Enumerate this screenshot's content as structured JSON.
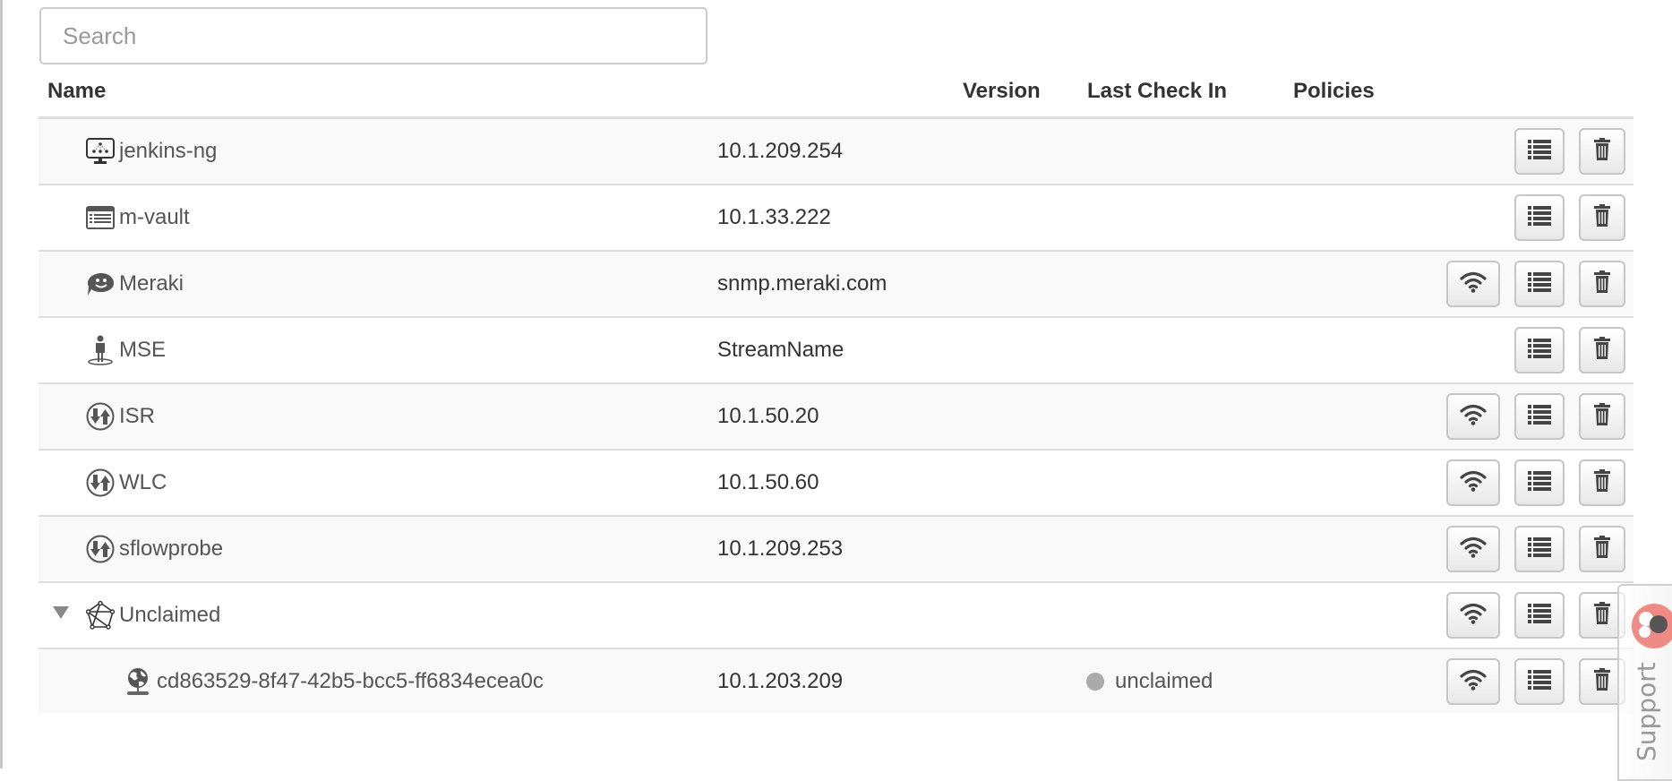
{
  "search": {
    "placeholder": "Search",
    "value": ""
  },
  "table": {
    "columns": [
      "Name",
      "Version",
      "Last Check In",
      "Policies"
    ],
    "rows": [
      {
        "name": "jenkins-ng",
        "icon": "monitor-network-icon",
        "address": "10.1.209.254",
        "status": "",
        "actions": [
          "list",
          "delete"
        ]
      },
      {
        "name": "m-vault",
        "icon": "server-list-icon",
        "address": "10.1.33.222",
        "status": "",
        "actions": [
          "list",
          "delete"
        ]
      },
      {
        "name": "Meraki",
        "icon": "speech-bubble-smile-icon",
        "address": "snmp.meraki.com",
        "status": "",
        "actions": [
          "snmp",
          "list",
          "delete"
        ]
      },
      {
        "name": "MSE",
        "icon": "person-location-icon",
        "address": "StreamName",
        "status": "",
        "actions": [
          "list",
          "delete"
        ]
      },
      {
        "name": "ISR",
        "icon": "router-arrows-icon",
        "address": "10.1.50.20",
        "status": "",
        "actions": [
          "snmp",
          "list",
          "delete"
        ]
      },
      {
        "name": "WLC",
        "icon": "router-arrows-icon",
        "address": "10.1.50.60",
        "status": "",
        "actions": [
          "snmp",
          "list",
          "delete"
        ]
      },
      {
        "name": "sflowprobe",
        "icon": "router-arrows-icon",
        "address": "10.1.209.253",
        "status": "",
        "actions": [
          "snmp",
          "list",
          "delete"
        ]
      },
      {
        "name": "Unclaimed",
        "icon": "network-polygon-icon",
        "address": "",
        "status": "",
        "group": true,
        "expanded": true,
        "actions": [
          "snmp",
          "list",
          "delete"
        ]
      },
      {
        "name": "cd863529-8f47-42b5-bcc5-ff6834ecea0c",
        "icon": "globe-stand-icon",
        "address": "10.1.203.209",
        "status": "unclaimed",
        "child": true,
        "actions": [
          "snmp",
          "list",
          "delete"
        ]
      }
    ]
  },
  "support": {
    "label": "Support"
  },
  "colors": {
    "status_unclaimed": "#aaaaaa",
    "support_badge": "#f08a85"
  }
}
